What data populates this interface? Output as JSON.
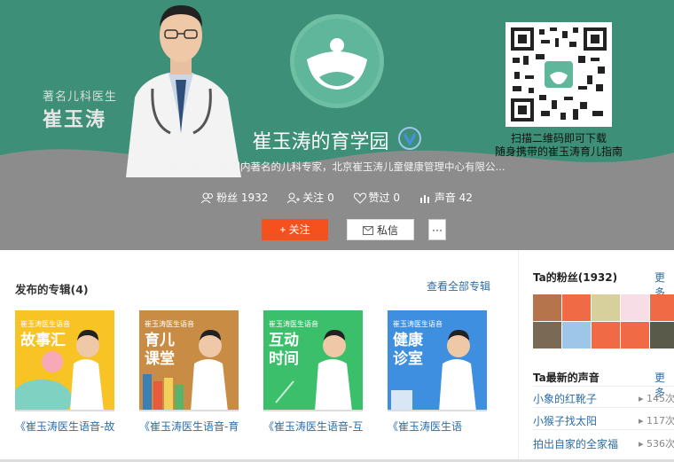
{
  "header": {
    "doctor_subtitle": "著名儿科医生",
    "doctor_name": "崔玉涛",
    "title": "崔玉涛的育学园",
    "description": "崔玉涛医生是国内著名的儿科专家，北京崔玉涛儿童健康管理中心有限公...",
    "qr_text_line1": "扫描二维码即可下载",
    "qr_text_line2": "随身携带的崔玉涛育儿指南"
  },
  "stats": {
    "fans": "粉丝 1932",
    "following": "关注 0",
    "likes": "赞过 0",
    "sounds": "声音 42"
  },
  "actions": {
    "follow_label": "关注",
    "message_label": "私信",
    "more_label": "···"
  },
  "albums": {
    "heading": "发布的专辑(4)",
    "view_all": "查看全部专辑",
    "items": [
      {
        "brand": "崔玉涛医生语音",
        "big": "故事汇",
        "title": "《崔玉涛医生语音-故",
        "color": "#f7c325"
      },
      {
        "brand": "崔玉涛医生语音",
        "big": "育儿课堂",
        "title": "《崔玉涛医生语音-育",
        "color": "#c98c45"
      },
      {
        "brand": "崔玉涛医生语音",
        "big": "互动时间",
        "title": "《崔玉涛医生语音-互",
        "color": "#3cbf6a"
      },
      {
        "brand": "崔玉涛医生语音",
        "big": "健康诊室",
        "title": "《崔玉涛医生语",
        "color": "#3f8fe0"
      }
    ]
  },
  "sidebar": {
    "fans_heading": "Ta的粉丝(1932)",
    "fans_more": "更多",
    "sounds_heading": "Ta最新的声音",
    "sounds_more": "更多",
    "tracks": [
      {
        "title": "小象的红靴子",
        "count": "145次"
      },
      {
        "title": "小猴子找太阳",
        "count": "117次"
      },
      {
        "title": "拍出自家的全家福",
        "count": "536次"
      }
    ]
  },
  "colors": {
    "accent_green": "#3d8f77",
    "follow_orange": "#f4511e",
    "link_blue": "#2e6da4"
  }
}
